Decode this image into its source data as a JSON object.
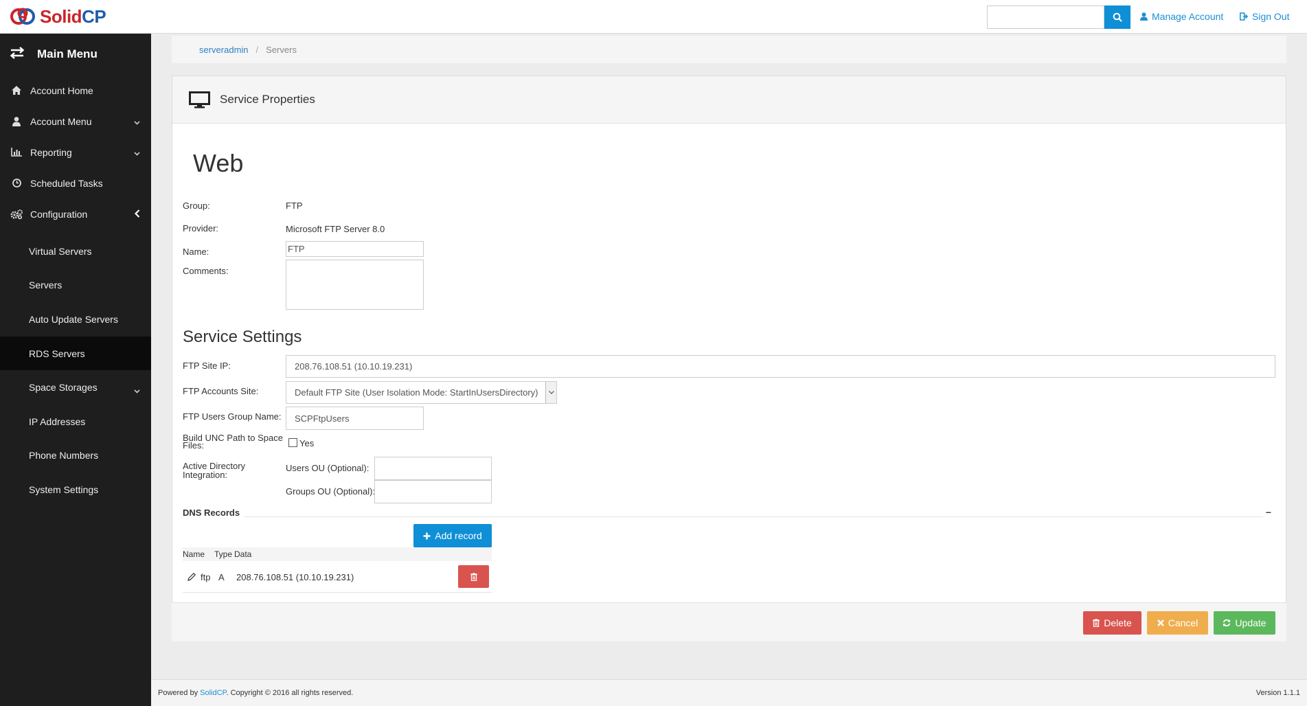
{
  "brand": {
    "logo_part1": "Solid",
    "logo_part2": "CP"
  },
  "top": {
    "search_placeholder": "",
    "manage_account": "Manage Account",
    "sign_out": "Sign Out"
  },
  "sidebar": {
    "title": "Main Menu",
    "items": [
      {
        "label": "Account Home",
        "icon": "home-icon"
      },
      {
        "label": "Account Menu",
        "icon": "user-icon"
      },
      {
        "label": "Reporting",
        "icon": "bar-chart-icon"
      },
      {
        "label": "Scheduled Tasks",
        "icon": "clock-icon"
      },
      {
        "label": "Configuration",
        "icon": "gears-icon"
      }
    ],
    "sub": [
      "Virtual Servers",
      "Servers",
      "Auto Update Servers",
      "RDS Servers",
      "Space Storages",
      "IP Addresses",
      "Phone Numbers",
      "System Settings"
    ]
  },
  "breadcrumb": {
    "root": "serveradmin",
    "separator": "/",
    "current": "Servers"
  },
  "panel": {
    "title": "Service Properties",
    "heading": "Web",
    "group_label": "Group:",
    "group_value": "FTP",
    "provider_label": "Provider:",
    "provider_value": "Microsoft FTP Server 8.0",
    "name_label": "Name:",
    "name_value": "FTP",
    "comments_label": "Comments:",
    "comments_value": "",
    "settings_heading": "Service Settings",
    "ftp_ip_label": "FTP Site IP:",
    "ftp_ip_value": "208.76.108.51 (10.10.19.231)",
    "ftp_accounts_label": "FTP Accounts Site:",
    "ftp_accounts_value": "Default FTP Site (User Isolation Mode: StartInUsersDirectory)",
    "ftp_group_label": "FTP Users Group Name:",
    "ftp_group_value": "SCPFtpUsers",
    "unc_label_1": "Build UNC Path to Space",
    "unc_label_2": "Files:",
    "unc_yes": "Yes",
    "ad_label_1": "Active Directory",
    "ad_label_2": "Integration:",
    "users_ou_label": "Users OU (Optional):",
    "groups_ou_label": "Groups OU (Optional):",
    "users_ou_value": "",
    "groups_ou_value": "",
    "dns_heading": "DNS Records",
    "dns_collapse": "–",
    "add_record": "Add record",
    "dns_columns": [
      "Name",
      "Type",
      "Data"
    ],
    "dns_rows": [
      {
        "name": "ftp",
        "type": "A",
        "data": "208.76.108.51 (10.10.19.231)"
      }
    ]
  },
  "actions": {
    "delete": "Delete",
    "cancel": "Cancel",
    "update": "Update"
  },
  "footer": {
    "powered_prefix": "Powered by ",
    "powered_link": "SolidCP",
    "powered_suffix": ". Copyright © 2016 all rights reserved.",
    "version": "Version 1.1.1"
  }
}
